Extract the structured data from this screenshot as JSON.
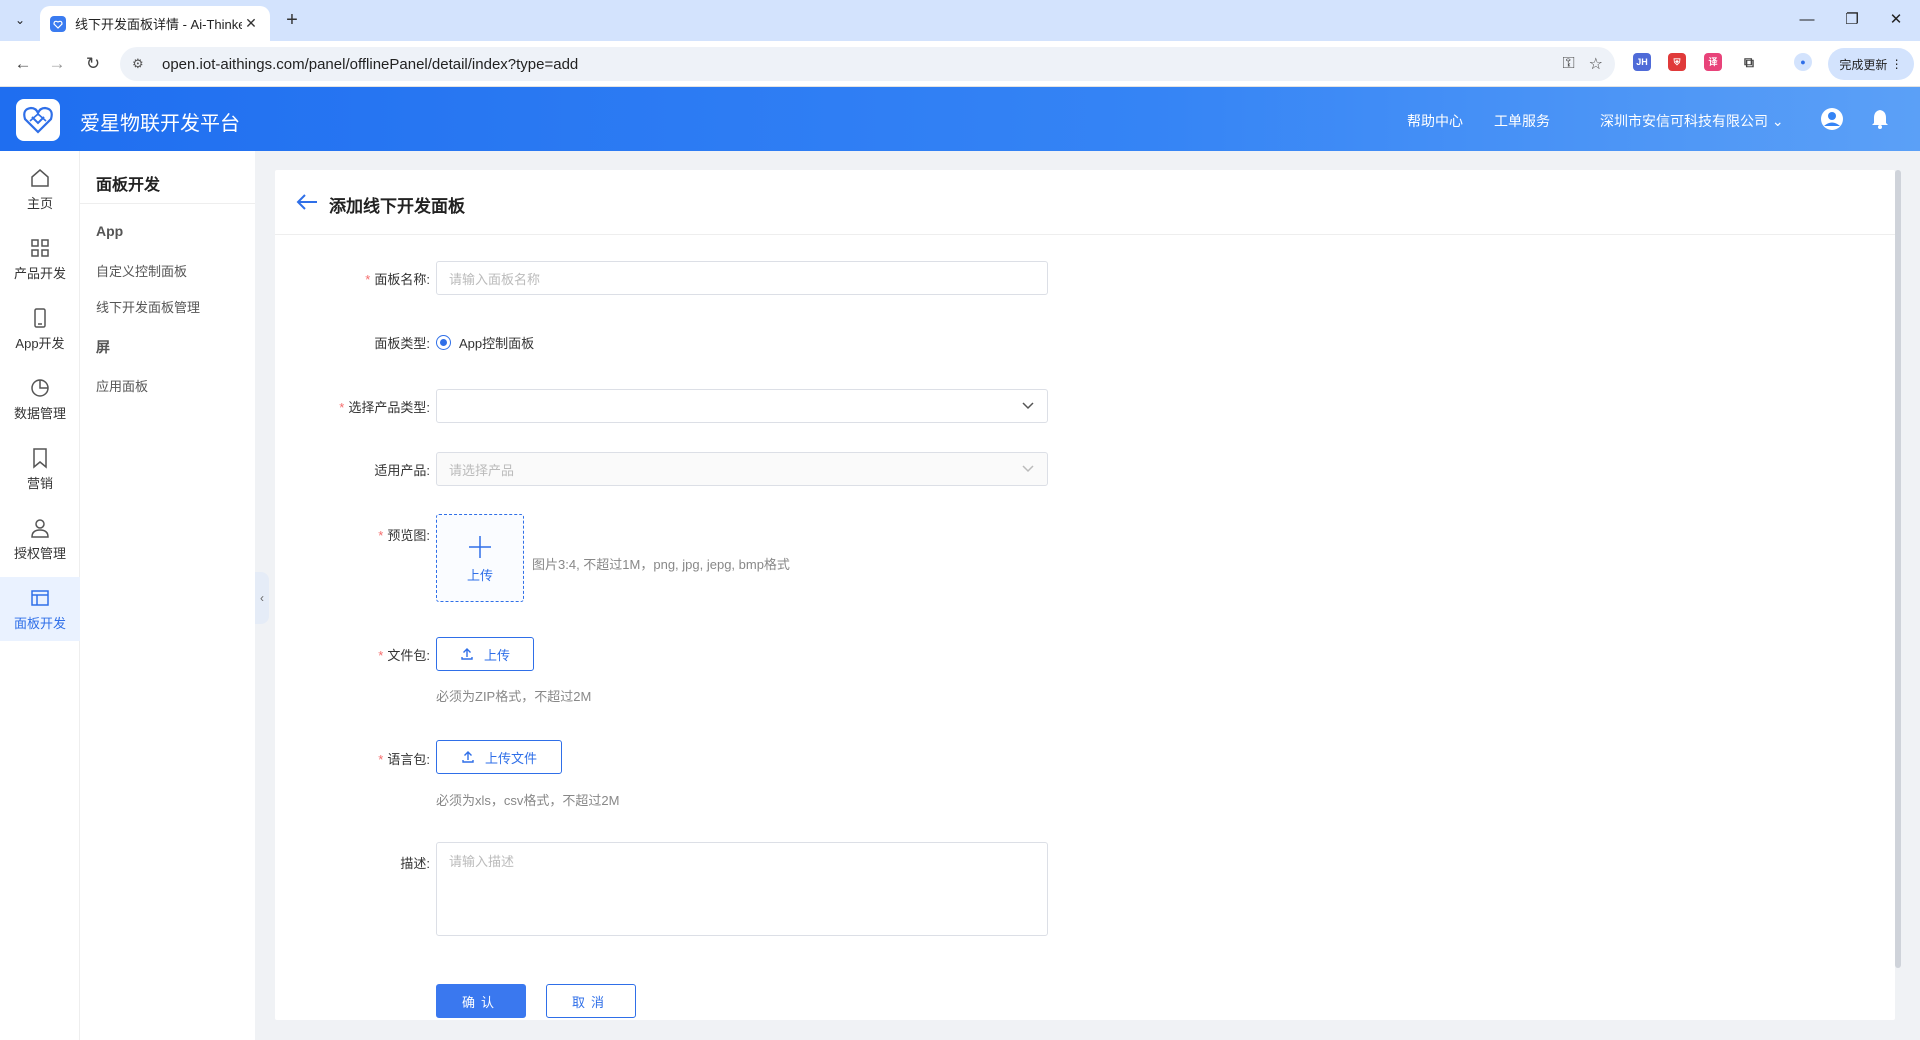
{
  "browser": {
    "tab_title": "线下开发面板详情 - Ai-Thinker",
    "url": "open.iot-aithings.com/panel/offlinePanel/detail/index?type=add",
    "update_label": "完成更新",
    "extensions": [
      {
        "name": "JH",
        "color": "#4f6bd8"
      },
      {
        "name": "shield-ext",
        "color": "#e03a3a"
      },
      {
        "name": "translate-ext",
        "color": "#e8437a"
      }
    ]
  },
  "header": {
    "brand": "爱星物联开发平台",
    "help": "帮助中心",
    "ticket": "工单服务",
    "company": "深圳市安信可科技有限公司"
  },
  "rail": {
    "items": [
      {
        "label": "主页",
        "icon": "home-icon"
      },
      {
        "label": "产品开发",
        "icon": "grid-icon"
      },
      {
        "label": "App开发",
        "icon": "phone-icon"
      },
      {
        "label": "数据管理",
        "icon": "pie-chart-icon"
      },
      {
        "label": "营销",
        "icon": "bookmark-icon"
      },
      {
        "label": "授权管理",
        "icon": "user-icon"
      },
      {
        "label": "面板开发",
        "icon": "panel-icon"
      }
    ]
  },
  "submenu": {
    "title": "面板开发",
    "group_app": "App",
    "item_custom": "自定义控制面板",
    "item_offline": "线下开发面板管理",
    "group_screen": "屏",
    "item_apply": "应用面板"
  },
  "form": {
    "title": "添加线下开发面板",
    "name_label": "面板名称",
    "name_placeholder": "请输入面板名称",
    "type_label": "面板类型",
    "type_option": "App控制面板",
    "product_type_label": "选择产品类型",
    "product_label": "适用产品",
    "product_placeholder": "请选择产品",
    "preview_label": "预览图",
    "preview_upload": "上传",
    "preview_hint": "图片3:4, 不超过1M，png, jpg, jepg, bmp格式",
    "file_label": "文件包",
    "file_upload": "上传",
    "file_hint": "必须为ZIP格式，不超过2M",
    "lang_label": "语言包",
    "lang_upload": "上传文件",
    "lang_hint": "必须为xls，csv格式，不超过2M",
    "desc_label": "描述",
    "desc_placeholder": "请输入描述",
    "confirm": "确认",
    "cancel": "取消"
  }
}
